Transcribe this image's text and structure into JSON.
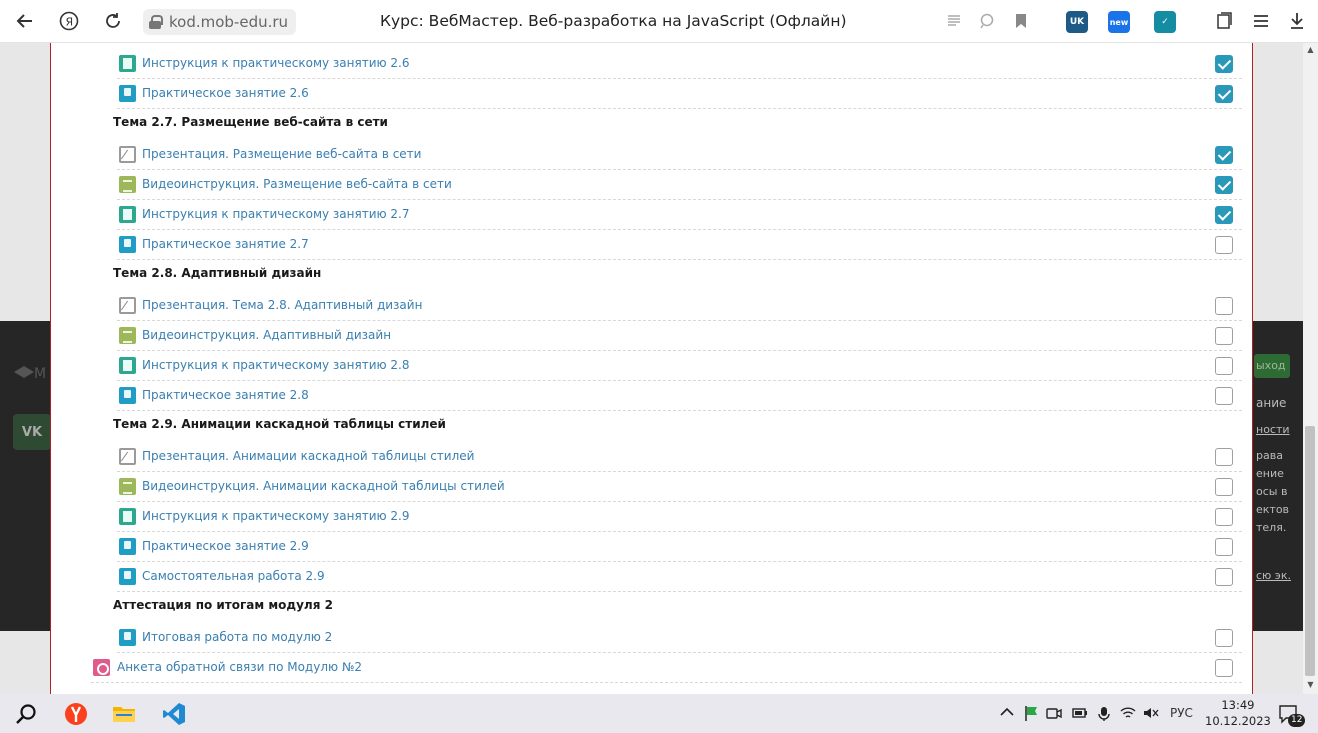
{
  "browser": {
    "url": "kod.mob-edu.ru",
    "title": "Курс: ВебМастер. Веб-разработка на JavaScript (Офлайн)",
    "ext_uk": "UK",
    "ext_new": "new",
    "colors": {
      "ext_uk": "#1e5a86",
      "ext_new": "#1a73e8",
      "ext_third": "#148da3"
    }
  },
  "background": {
    "fragments": [
      "ыход",
      "ание",
      "ности",
      "рава",
      "ение",
      "осы в",
      "ектов",
      "теля.",
      "сю эк."
    ]
  },
  "course": {
    "top_items": [
      {
        "icon": "instruction-icon",
        "label": "Инструкция к практическому занятию 2.6",
        "checked": true
      },
      {
        "icon": "practice-icon",
        "label": "Практическое занятие 2.6",
        "checked": true
      }
    ],
    "sections": [
      {
        "title": "Тема 2.7. Размещение веб-сайта в сети",
        "items": [
          {
            "icon": "presentation-icon",
            "label": "Презентация. Размещение веб-сайта в сети",
            "checked": true
          },
          {
            "icon": "video-icon",
            "label": "Видеоинструкция. Размещение веб-сайта в сети",
            "checked": true
          },
          {
            "icon": "instruction-icon",
            "label": "Инструкция к практическому занятию 2.7",
            "checked": true
          },
          {
            "icon": "practice-icon",
            "label": "Практическое занятие 2.7",
            "checked": false
          }
        ]
      },
      {
        "title": "Тема 2.8. Адаптивный дизайн",
        "items": [
          {
            "icon": "presentation-icon",
            "label": "Презентация. Тема 2.8. Адаптивный дизайн",
            "checked": false
          },
          {
            "icon": "video-icon",
            "label": "Видеоинструкция. Адаптивный дизайн",
            "checked": false
          },
          {
            "icon": "instruction-icon",
            "label": "Инструкция к практическому занятию 2.8",
            "checked": false
          },
          {
            "icon": "practice-icon",
            "label": "Практическое занятие 2.8",
            "checked": false
          }
        ]
      },
      {
        "title": "Тема 2.9. Анимации каскадной таблицы стилей",
        "items": [
          {
            "icon": "presentation-icon",
            "label": "Презентация. Анимации каскадной таблицы стилей",
            "checked": false
          },
          {
            "icon": "video-icon",
            "label": "Видеоинструкция. Анимации каскадной таблицы стилей",
            "checked": false
          },
          {
            "icon": "instruction-icon",
            "label": "Инструкция к практическому занятию 2.9",
            "checked": false
          },
          {
            "icon": "practice-icon",
            "label": "Практическое занятие 2.9",
            "checked": false
          },
          {
            "icon": "practice-icon",
            "label": "Самостоятельная работа 2.9",
            "checked": false
          }
        ]
      },
      {
        "title": "Аттестация по итогам модуля 2",
        "items": [
          {
            "icon": "practice-icon",
            "label": "Итоговая работа по модулю 2",
            "checked": false
          }
        ]
      }
    ],
    "feedback": {
      "icon": "feedback-form-icon",
      "label": "Анкета обратной связи по Модулю №2",
      "checked": false
    }
  },
  "taskbar": {
    "language": "РУС",
    "time": "13:49",
    "date": "10.12.2023",
    "notifications": "12"
  }
}
